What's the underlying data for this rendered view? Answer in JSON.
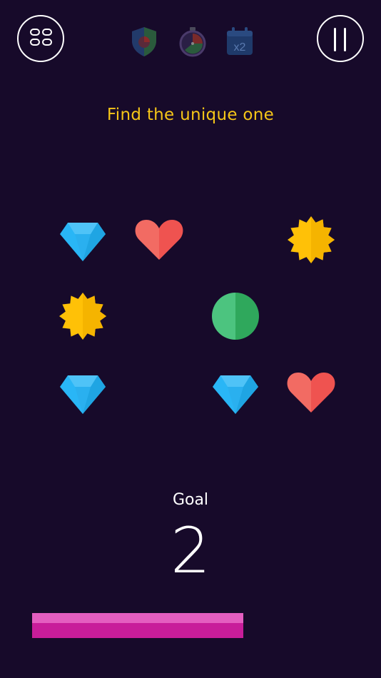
{
  "header": {
    "menu_icon": "grid-menu-icon",
    "pause_icon": "pause-icon",
    "powerups": [
      {
        "icon": "shield-powerup-icon",
        "active": false
      },
      {
        "icon": "timer-powerup-icon",
        "active": false
      },
      {
        "icon": "calendar-x2-powerup-icon",
        "label": "x2",
        "active": false
      }
    ]
  },
  "game": {
    "instruction": "Find the unique one",
    "grid": [
      [
        "diamond",
        "heart",
        "",
        "sun"
      ],
      [
        "sun",
        "",
        "circle",
        ""
      ],
      [
        "diamond",
        "",
        "diamond",
        "heart"
      ]
    ]
  },
  "goal": {
    "label": "Goal",
    "value": "2"
  },
  "progress": {
    "fraction": 0.555,
    "colors": [
      "#e45ec0",
      "#c81d9a"
    ]
  },
  "colors": {
    "background": "#170a2a",
    "title": "#f5c518",
    "diamond": "#29b6f6",
    "heart": "#ef5350",
    "sun": "#ffc107",
    "circle": "#3dbb70"
  }
}
